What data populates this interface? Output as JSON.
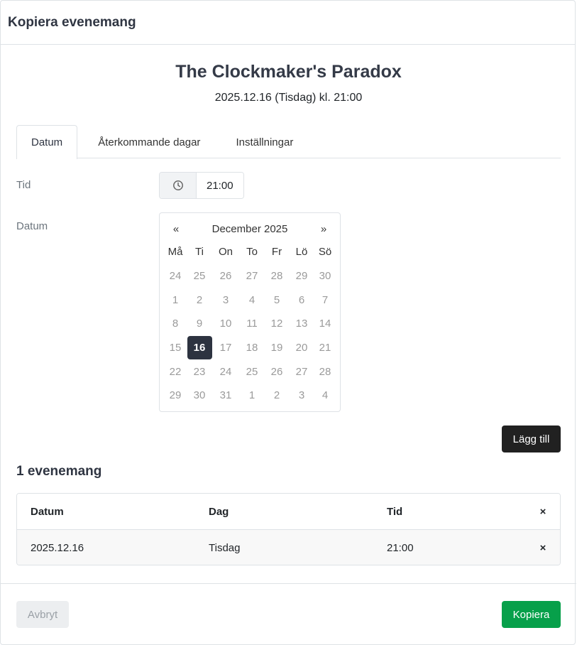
{
  "modal": {
    "title": "Kopiera evenemang"
  },
  "event": {
    "title": "The Clockmaker's Paradox",
    "datetime": "2025.12.16 (Tisdag) kl. 21:00"
  },
  "tabs": [
    {
      "label": "Datum",
      "active": true
    },
    {
      "label": "Återkommande dagar",
      "active": false
    },
    {
      "label": "Inställningar",
      "active": false
    }
  ],
  "form": {
    "time_label": "Tid",
    "time_value": "21:00",
    "time_icon": "clock-icon",
    "date_label": "Datum"
  },
  "calendar": {
    "prev": "«",
    "next": "»",
    "month": "December 2025",
    "weekdays": [
      "Må",
      "Ti",
      "On",
      "To",
      "Fr",
      "Lö",
      "Sö"
    ],
    "weeks": [
      [
        "24",
        "25",
        "26",
        "27",
        "28",
        "29",
        "30"
      ],
      [
        "1",
        "2",
        "3",
        "4",
        "5",
        "6",
        "7"
      ],
      [
        "8",
        "9",
        "10",
        "11",
        "12",
        "13",
        "14"
      ],
      [
        "15",
        "16",
        "17",
        "18",
        "19",
        "20",
        "21"
      ],
      [
        "22",
        "23",
        "24",
        "25",
        "26",
        "27",
        "28"
      ],
      [
        "29",
        "30",
        "31",
        "1",
        "2",
        "3",
        "4"
      ]
    ],
    "selected": "16",
    "selected_color": "#2d3340"
  },
  "add_button": "Lägg till",
  "events_heading": "1 evenemang",
  "table": {
    "headers": [
      "Datum",
      "Dag",
      "Tid",
      "×"
    ],
    "rows": [
      {
        "date": "2025.12.16",
        "day": "Tisdag",
        "time": "21:00",
        "remove": "×"
      }
    ]
  },
  "footer": {
    "cancel": "Avbryt",
    "copy": "Kopiera",
    "copy_color": "#07a04a"
  }
}
